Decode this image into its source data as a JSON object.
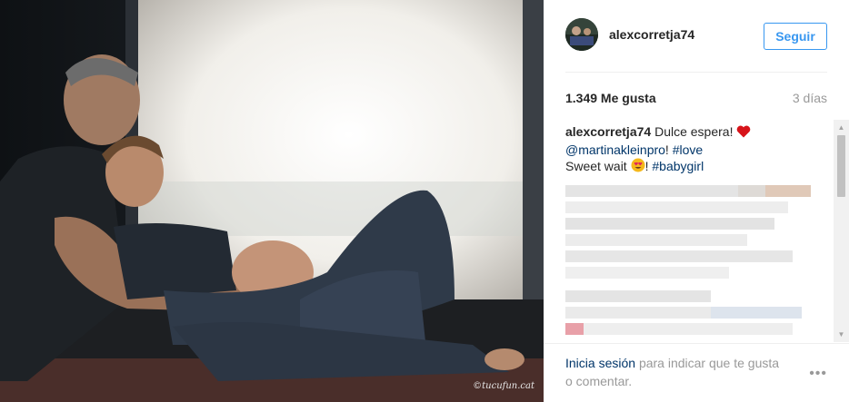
{
  "photo": {
    "credit": "©tucufun.cat",
    "alt": "photo"
  },
  "header": {
    "username": "alexcorretja74",
    "follow_label": "Seguir"
  },
  "stats": {
    "likes": "1.349 Me gusta",
    "time": "3 días"
  },
  "caption": {
    "username": "alexcorretja74",
    "text1": "Dulce espera!",
    "mention": "@martinakleinpro",
    "sep": "!",
    "hashtag1": "#love",
    "text2": "Sweet wait",
    "text3": "!",
    "hashtag2": "#babygirl"
  },
  "footer": {
    "login_link": "Inicia sesión",
    "login_text": "para indicar que te gusta o comentar.",
    "more_label": "•••"
  },
  "colors": {
    "accent": "#3897f0",
    "link": "#003569",
    "muted": "#999999",
    "text": "#262626",
    "heart": "#ed4956"
  },
  "icons": [
    "heart-icon",
    "heart-eyes-emoji-icon",
    "more-options-icon",
    "scroll-up-icon",
    "scroll-down-icon"
  ]
}
